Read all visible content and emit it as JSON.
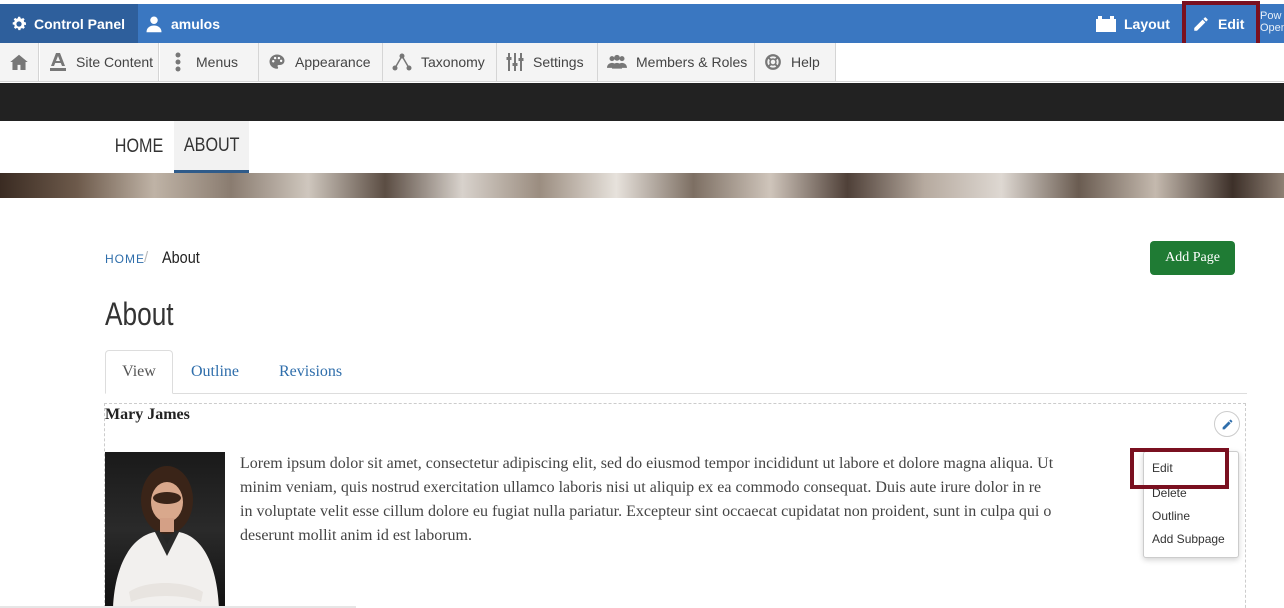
{
  "topbar": {
    "control_panel": "Control Panel",
    "user": "amulos",
    "layout": "Layout",
    "edit": "Edit",
    "powered_line1": "Pow",
    "powered_line2": "Open"
  },
  "admin_menu": {
    "items": [
      {
        "label": "Site Content",
        "icon": "site-content-icon"
      },
      {
        "label": "Menus",
        "icon": "menus-icon"
      },
      {
        "label": "Appearance",
        "icon": "palette-icon"
      },
      {
        "label": "Taxonomy",
        "icon": "taxonomy-icon"
      },
      {
        "label": "Settings",
        "icon": "sliders-icon"
      },
      {
        "label": "Members & Roles",
        "icon": "members-icon"
      },
      {
        "label": "Help",
        "icon": "help-icon"
      }
    ]
  },
  "site_nav": {
    "home": "HOME",
    "about": "ABOUT"
  },
  "breadcrumb": {
    "home": "HOME",
    "separator": "/",
    "current": "About"
  },
  "add_page": "Add Page",
  "page_title": "About",
  "tabs": {
    "view": "View",
    "outline": "Outline",
    "revisions": "Revisions"
  },
  "content": {
    "name": "Mary James",
    "lines": [
      "Lorem ipsum dolor sit amet, consectetur adipiscing elit, sed do eiusmod tempor incididunt ut labore et dolore magna aliqua. Ut",
      "minim veniam, quis nostrud exercitation ullamco laboris nisi ut aliquip ex ea commodo consequat. Duis aute irure dolor in re",
      "in voluptate velit esse cillum dolore eu fugiat nulla pariatur. Excepteur sint occaecat cupidatat non proident, sunt in culpa qui o",
      "deserunt mollit anim id est laborum."
    ]
  },
  "dropdown": {
    "items": [
      "Edit",
      "Delete",
      "Outline",
      "Add Subpage"
    ]
  },
  "colors": {
    "topbar": "#3a77c1",
    "control_panel_bg": "#2e5f9c",
    "highlight": "#7a1020",
    "link": "#2f6eab",
    "add_page": "#1f7b34"
  }
}
